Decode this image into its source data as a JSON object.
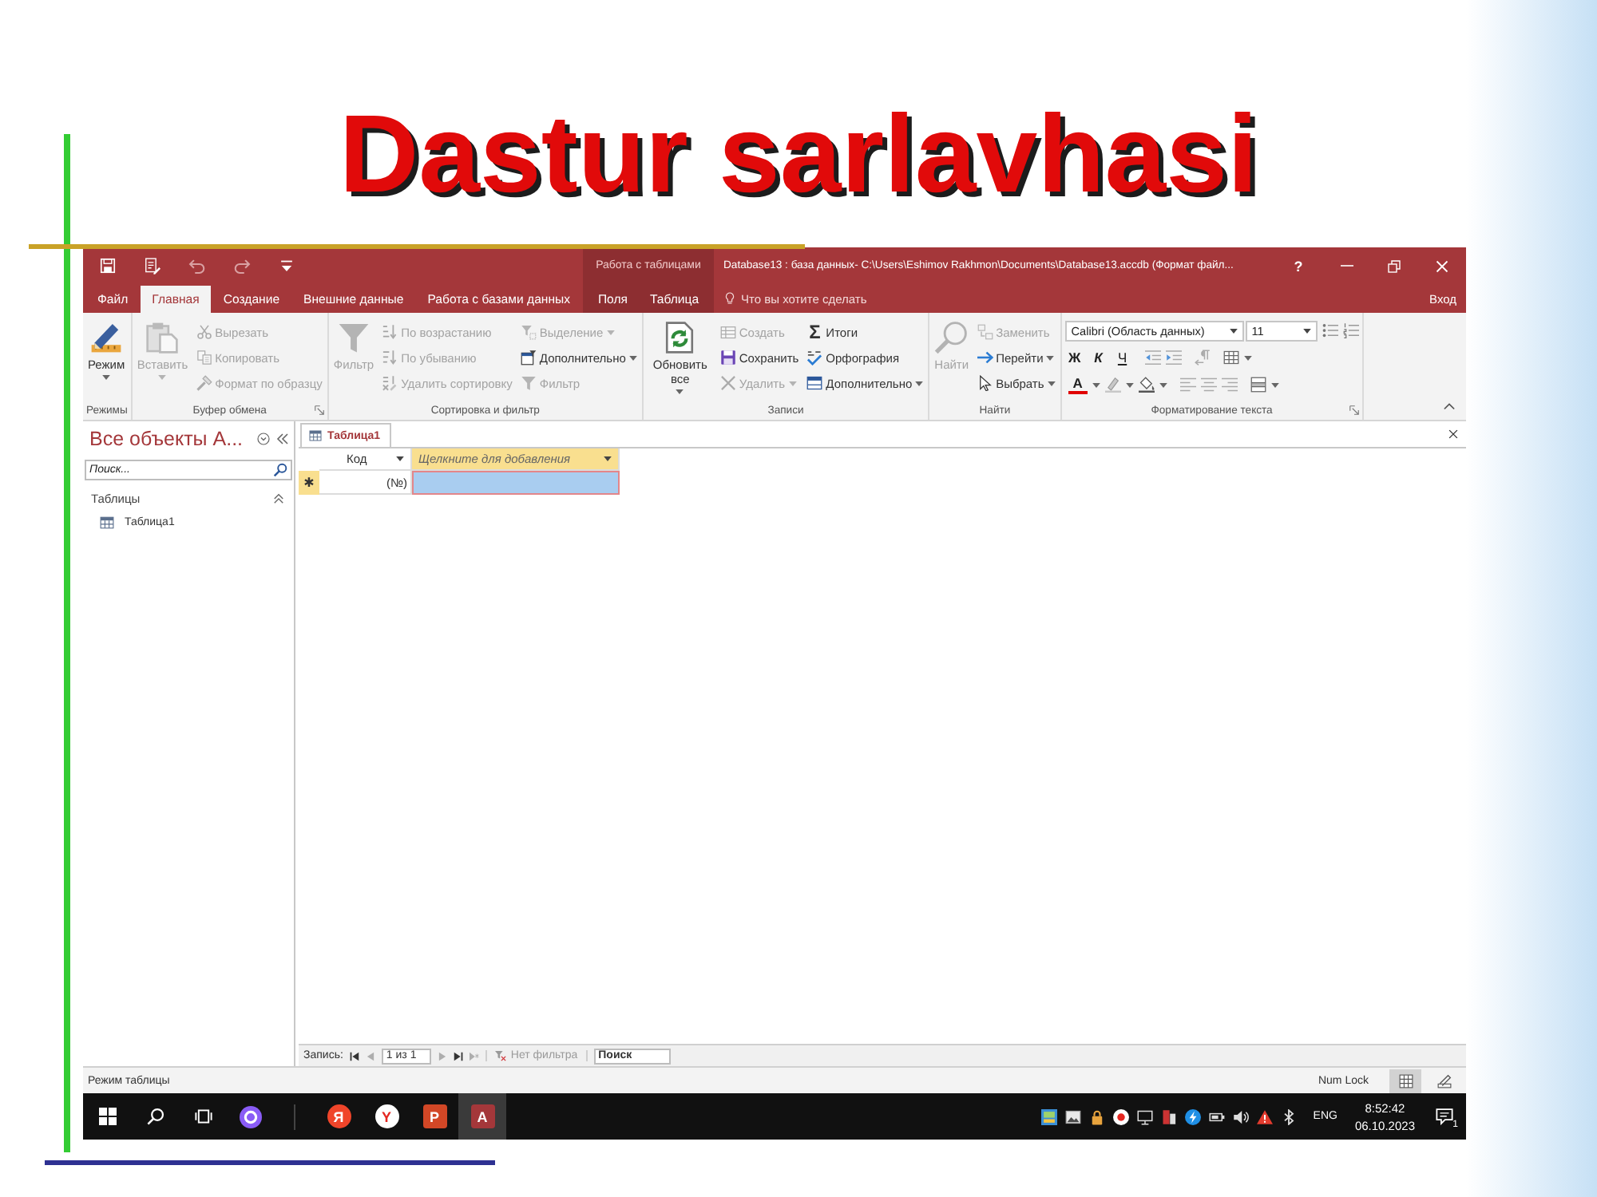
{
  "slide": {
    "title": "Dastur sarlavhasi"
  },
  "window": {
    "context_label": "Работа с таблицами",
    "title": "Database13 : база данных- C:\\Users\\Eshimov Rakhmon\\Documents\\Database13.accdb (Формат файл...",
    "help": "?",
    "tabs": [
      {
        "label": "Файл",
        "selected": false,
        "contextual": false
      },
      {
        "label": "Главная",
        "selected": true,
        "contextual": false
      },
      {
        "label": "Создание",
        "selected": false,
        "contextual": false
      },
      {
        "label": "Внешние данные",
        "selected": false,
        "contextual": false
      },
      {
        "label": "Работа с базами данных",
        "selected": false,
        "contextual": false
      },
      {
        "label": "Поля",
        "selected": false,
        "contextual": true
      },
      {
        "label": "Таблица",
        "selected": false,
        "contextual": true
      }
    ],
    "tell_me": {
      "placeholder": "Что вы хотите сделать"
    },
    "sign_in": "Вход"
  },
  "ribbon": {
    "groups": [
      {
        "label": "Режимы",
        "launcher": false,
        "items": [
          {
            "kind": "large",
            "label": "Режим",
            "disabled": false,
            "menu": true
          }
        ]
      },
      {
        "label": "Буфер обмена",
        "launcher": true,
        "items": [
          {
            "kind": "large",
            "label": "Вставить",
            "disabled": true,
            "menu": true
          },
          {
            "kind": "stack",
            "items": [
              {
                "label": "Вырезать",
                "disabled": true,
                "menu": false
              },
              {
                "label": "Копировать",
                "disabled": true,
                "menu": false
              },
              {
                "label": "Формат по образцу",
                "disabled": true,
                "menu": false
              }
            ]
          }
        ]
      },
      {
        "label": "Сортировка и фильтр",
        "launcher": false,
        "items": [
          {
            "kind": "large",
            "label": "Фильтр",
            "disabled": true,
            "menu": false
          },
          {
            "kind": "stack",
            "items": [
              {
                "label": "По возрастанию",
                "disabled": true,
                "menu": false
              },
              {
                "label": "По убыванию",
                "disabled": true,
                "menu": false
              },
              {
                "label": "Удалить сортировку",
                "disabled": true,
                "menu": false
              }
            ]
          },
          {
            "kind": "stack",
            "items": [
              {
                "label": "Выделение",
                "disabled": true,
                "menu": true
              },
              {
                "label": "Дополнительно",
                "disabled": false,
                "menu": true
              },
              {
                "label": "Фильтр",
                "disabled": true,
                "menu": false
              }
            ]
          }
        ]
      },
      {
        "label": "Записи",
        "launcher": false,
        "items": [
          {
            "kind": "large",
            "label": "Обновить все",
            "disabled": false,
            "menu": true
          },
          {
            "kind": "stack",
            "items": [
              {
                "label": "Создать",
                "disabled": true,
                "menu": false
              },
              {
                "label": "Сохранить",
                "disabled": false,
                "menu": false
              },
              {
                "label": "Удалить",
                "disabled": true,
                "menu": true
              }
            ]
          },
          {
            "kind": "stack",
            "items": [
              {
                "label": "Итоги",
                "glyph": "Σ",
                "disabled": false,
                "menu": false
              },
              {
                "label": "Орфография",
                "disabled": false,
                "menu": false
              },
              {
                "label": "Дополнительно",
                "disabled": false,
                "menu": true
              }
            ]
          }
        ]
      },
      {
        "label": "Найти",
        "launcher": false,
        "items": [
          {
            "kind": "large",
            "label": "Найти",
            "disabled": true,
            "menu": false
          },
          {
            "kind": "stack",
            "items": [
              {
                "label": "Заменить",
                "disabled": true,
                "menu": false
              },
              {
                "label": "Перейти",
                "disabled": false,
                "menu": true
              },
              {
                "label": "Выбрать",
                "disabled": false,
                "menu": true
              }
            ]
          }
        ]
      },
      {
        "label": "Форматирование текста",
        "launcher": true,
        "items": [
          {
            "kind": "format",
            "font": "Calibri (Область данных)",
            "size": "11",
            "styles": [
              "Ж",
              "К",
              "Ч"
            ],
            "font_color": "A"
          }
        ]
      }
    ]
  },
  "navigation_pane": {
    "title": "Все объекты A...",
    "search": {
      "placeholder": "Поиск..."
    },
    "sections": [
      {
        "label": "Таблицы",
        "expanded": true,
        "items": [
          {
            "label": "Таблица1",
            "selected": false
          }
        ]
      }
    ]
  },
  "datasheet": {
    "tabs": [
      {
        "label": "Таблица1",
        "selected": true
      }
    ],
    "columns": [
      {
        "label": "Код",
        "kind": "field"
      },
      {
        "label": "Щелкните для добавления",
        "kind": "add"
      }
    ],
    "new_row": {
      "selector": "✱",
      "cells": [
        {
          "text": "(№)",
          "selected": false
        },
        {
          "selected": true
        }
      ]
    }
  },
  "record_navigator": {
    "label": "Запись:",
    "buttons": [
      {
        "disabled": false
      },
      {
        "disabled": true
      },
      {
        "disabled": true
      },
      {
        "disabled": false
      },
      {
        "disabled": true
      }
    ],
    "position": "1 из 1",
    "filter": "Нет фильтра",
    "search": {
      "placeholder": "Поиск"
    }
  },
  "status_bar": {
    "mode": "Режим таблицы",
    "indicators": [
      "Num Lock"
    ],
    "views": [
      {
        "selected": true
      },
      {
        "selected": false
      }
    ]
  },
  "taskbar": {
    "apps": [
      {
        "glyph": "Я",
        "kind": "round",
        "color": "#f0452a",
        "selected": false
      },
      {
        "glyph": "Y",
        "kind": "round",
        "color": "#ffffff",
        "selected": false
      },
      {
        "glyph": "P",
        "kind": "square",
        "color": "#d24726",
        "selected": false
      },
      {
        "glyph": "A",
        "kind": "square",
        "color": "#a4373a",
        "selected": true
      }
    ],
    "language": "ENG",
    "time": "8:52:42",
    "date": "06.10.2023",
    "notifications": "1"
  }
}
